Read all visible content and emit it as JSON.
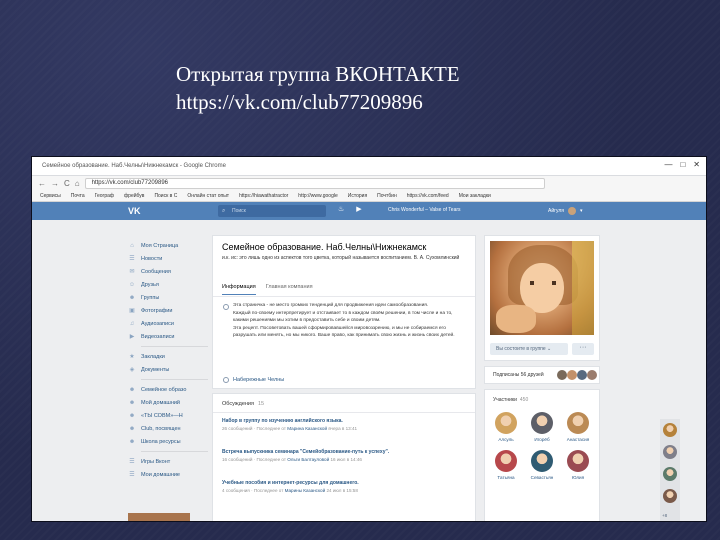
{
  "slide": {
    "title_line1": "Открытая группа ВКОНТАКТЕ",
    "title_line2": "https://vk.com/club77209896"
  },
  "browser": {
    "tab_title": "Семейное образование. Наб.Челны\\Нижнекамск - Google Chrome",
    "window_controls": [
      "—",
      "□",
      "✕"
    ],
    "address": "https://vk.com/club77209896",
    "nav_icons": [
      "←",
      "→",
      "C",
      "⌂"
    ],
    "bookmarks": [
      "Сервисы",
      "Почта",
      "Географ",
      "фрейбув",
      "Поиск в С",
      "Онлайн стат опыт",
      "https://hiawathatractor",
      "http://www.google",
      "История",
      "Почтбин",
      "https://vk.com/feed",
      "Мои закладки"
    ]
  },
  "vk_header": {
    "logo": "VK",
    "search_placeholder": "Поиск",
    "icons": [
      "bell-icon",
      "play-icon"
    ],
    "player_text": "Chris Wonderful – Valse of Tears",
    "user_name": "Айгуля"
  },
  "left_menu": {
    "items": [
      {
        "icon": "⌂",
        "label": "Моя Страница"
      },
      {
        "icon": "☰",
        "label": "Новости"
      },
      {
        "icon": "✉",
        "label": "Сообщения"
      },
      {
        "icon": "☺",
        "label": "Друзья"
      },
      {
        "icon": "☻",
        "label": "Группы"
      },
      {
        "icon": "▣",
        "label": "Фотографии"
      },
      {
        "icon": "♫",
        "label": "Аудиозаписи"
      },
      {
        "icon": "▶",
        "label": "Видеозаписи"
      }
    ],
    "items2": [
      {
        "icon": "★",
        "label": "Закладки"
      },
      {
        "icon": "◈",
        "label": "Документы"
      }
    ],
    "items3": [
      {
        "icon": "☻",
        "label": "Семейное образо"
      },
      {
        "icon": "☻",
        "label": "Мой домашний"
      },
      {
        "icon": "☻",
        "label": "«ТЫ СОВМ»—Н"
      },
      {
        "icon": "☻",
        "label": "Club, посвящен"
      },
      {
        "icon": "☻",
        "label": "Школа ресурсы"
      }
    ],
    "items4": [
      {
        "icon": "☰",
        "label": "Игры Вконт"
      },
      {
        "icon": "☰",
        "label": "Мои домашние"
      }
    ]
  },
  "group": {
    "title": "Семейное образование. Наб.Челны\\Нижнекамск",
    "status": "и.к. ис: это лишь одно из аспектов того цветка, который называется воспитанием. В. А. Сухомлинский",
    "tabs": [
      "Информация",
      "Главная компания"
    ],
    "description": [
      "Эта страничка - не место громких тенденций для продвижения идеи самообразования.",
      "Каждый по-своему интерпретирует и отстаивает то в каждом своём решении, в том числе и на то, какими решениями мы хотим в предоставить себе и своим детям.",
      "Эта рецепт. Посоветовать вашей сформировавшейся мировоззрению, и мы не собираемся его разрушать или менять, но мы никого. Ваше право, как принимать свою жизнь и жизнь своих детей."
    ],
    "website": "Набережные Челны"
  },
  "discussions": {
    "title": "Обсуждения",
    "count": "15",
    "topics": [
      {
        "title": "Набор в группу по изучению английского языка.",
        "count_text": "26 сообщений",
        "meta_prefix": "Последнее от",
        "author": "Марина Казанской",
        "date": "вчера в 13:41"
      },
      {
        "title": "Встреча выпускника семинара \"Семейобразование-путь к успеху\".",
        "count_text": "16 сообщений",
        "meta_prefix": "Последнее от",
        "author": "Ольги Балтауловой",
        "date": "16 июл в 14:46"
      },
      {
        "title": "Учебные пособия и интернет-ресурсы для домашнего.",
        "count_text": "4 сообщения",
        "meta_prefix": "Последнее от",
        "author": "Марины Казанской",
        "date": "24 июл в 15:58"
      }
    ]
  },
  "side": {
    "subscribe_label": "Вы состоите в группе ⌄",
    "more_label": "···",
    "friends_text": "Подписаны 56 друзей",
    "members_title": "Участники",
    "members_count": "450",
    "members": [
      {
        "name": "Алсуль",
        "color": "#d1a35f"
      },
      {
        "name": "Игорёб",
        "color": "#5d5f68"
      },
      {
        "name": "Анастасия",
        "color": "#bb8a54"
      },
      {
        "name": "Татьяна",
        "color": "#b7484b"
      },
      {
        "name": "Севастьян",
        "color": "#2f5b72"
      },
      {
        "name": "Юлия",
        "color": "#9a4b52"
      }
    ],
    "friend_colors": [
      "#7a6a5b",
      "#c3916a",
      "#586a80",
      "#9b7c6d"
    ]
  },
  "chat": {
    "colors": [
      "#b5823b",
      "#7f7f8a",
      "#5b7a6a",
      "#7a5a4a"
    ],
    "count": "+8"
  }
}
